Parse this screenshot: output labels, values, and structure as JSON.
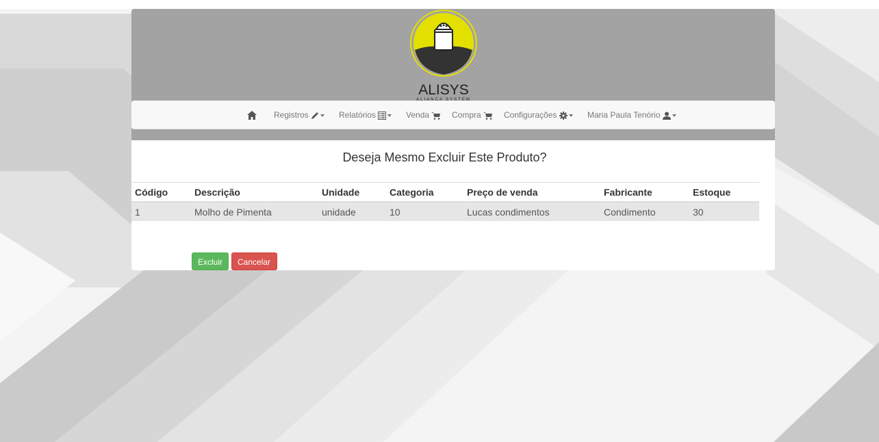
{
  "logo": {
    "name": "ALISYS",
    "tagline": "ALIANÇA SYSTEM",
    "accent_color": "#e3e000"
  },
  "nav": {
    "home_icon": "home-icon",
    "items": [
      {
        "label": "Registros",
        "icon": "pencil-icon",
        "dropdown": true
      },
      {
        "label": "Relatórios",
        "icon": "list-alt-icon",
        "dropdown": true
      },
      {
        "label": "Venda",
        "icon": "shopping-cart-icon",
        "dropdown": false
      },
      {
        "label": "Compra",
        "icon": "shopping-cart-icon",
        "dropdown": false
      },
      {
        "label": "Configurações",
        "icon": "cog-icon",
        "dropdown": true
      },
      {
        "label": "Maria Paula Tenório",
        "icon": "user-icon",
        "dropdown": true
      }
    ]
  },
  "page": {
    "title": "Deseja Mesmo Excluir Este Produto?"
  },
  "table": {
    "headers": [
      "Código",
      "Descrição",
      "Unidade",
      "Categoria",
      "Preço de venda",
      "Fabricante",
      "Estoque"
    ],
    "rows": [
      [
        "1",
        "Molho de Pimenta",
        "unidade",
        "10",
        "Lucas condimentos",
        "Condimento",
        "30"
      ]
    ]
  },
  "buttons": {
    "excluir": "Excluir",
    "cancelar": "Cancelar"
  },
  "colors": {
    "header_bg": "#a3a3a3",
    "navbar_bg": "#f8f8f8",
    "success": "#5cb85c",
    "danger": "#d9534f"
  }
}
